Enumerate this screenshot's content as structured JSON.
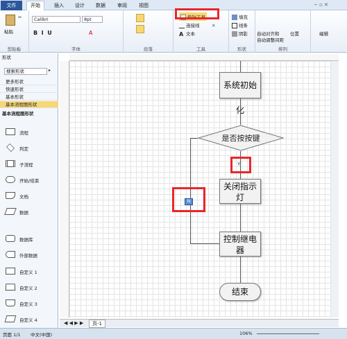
{
  "tabs": [
    "文件",
    "开始",
    "插入",
    "设计",
    "数据",
    "审阅",
    "视图"
  ],
  "ribbon": {
    "paste": "粘贴",
    "clipboard": "剪贴板",
    "font_name": "Calibri",
    "font_size": "8pt",
    "font_group": "字体",
    "paragraph_group": "段落",
    "pointer_tool": "指针工具",
    "connector": "连接线",
    "text": "文本",
    "tools_group": "工具",
    "fill": "填充",
    "line": "线条",
    "shadow": "阴影",
    "shape_group": "形状",
    "align": "自动对齐和",
    "align2": "自动调整间距",
    "position": "位置",
    "arrange_group": "排列",
    "edit": "编辑"
  },
  "left_panel": {
    "title": "形状",
    "search_placeholder": "搜索形状",
    "rows": [
      "更多形状",
      "快速形状",
      "基本形状",
      "基本流程图形状"
    ],
    "section": "基本流程图形状",
    "stencils": [
      "流程",
      "判定",
      "子流程",
      "开始/结束",
      "文档",
      "数据",
      "数据库",
      "外部数据",
      "自定义 1",
      "自定义 2",
      "自定义 3",
      "自定义 4"
    ]
  },
  "diagram": {
    "n1": "系统初始化",
    "n2": "是否按按键",
    "yes": "Y",
    "n3a": "关闭指示",
    "n3b": "灯",
    "n4a": "控制继电",
    "n4b": "器",
    "n5": "结束",
    "no": "N"
  },
  "page_tab": "页-1",
  "status": {
    "page": "页面 1/1",
    "lang": "中文(中国)",
    "zoom": "106%"
  },
  "colors": {
    "highlight": "#e8262a",
    "accent": "#2b579a"
  }
}
